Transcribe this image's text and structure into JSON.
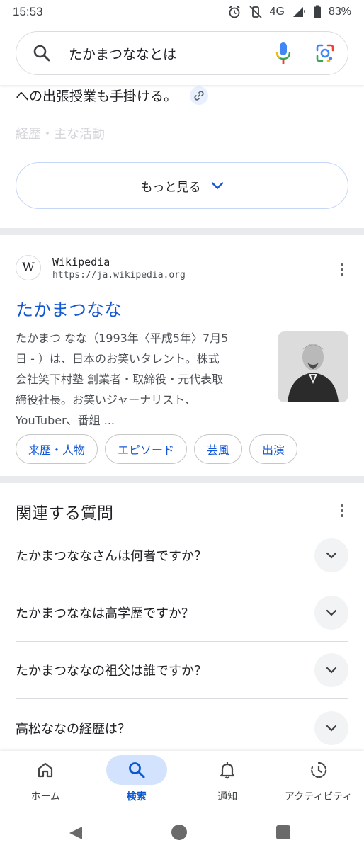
{
  "status_bar": {
    "time": "15:53",
    "network": "4G",
    "battery": "83%"
  },
  "search": {
    "query": "たかまつななとは"
  },
  "snippet": {
    "line": "への出張授業も手掛ける。",
    "faded_heading": "経歴・主な活動",
    "more_label": "もっと見る"
  },
  "result": {
    "favicon_letter": "W",
    "source_name": "Wikipedia",
    "source_url": "https://ja.wikipedia.org",
    "title": "たかまつなな",
    "snippet_lines": [
      "たかまつ なな（1993年〈平成5年〉7月5",
      "日 - ）は、日本のお笑いタレント。株式",
      "会社笑下村塾 創業者・取締役・元代表取",
      "締役社長。お笑いジャーナリスト、",
      "YouTuber、番組 ..."
    ],
    "chips": [
      "来歴・人物",
      "エピソード",
      "芸風",
      "出演"
    ]
  },
  "related_questions": {
    "title": "関連する質問",
    "items": [
      "たかまつななさんは何者ですか？",
      "たかまつななは高学歴ですか？",
      "たかまつななの祖父は誰ですか？",
      "高松ななの経歴は？"
    ]
  },
  "bottom_nav": {
    "items": [
      {
        "label": "ホーム",
        "icon": "home-icon",
        "active": false
      },
      {
        "label": "検索",
        "icon": "search-icon",
        "active": true
      },
      {
        "label": "通知",
        "icon": "bell-icon",
        "active": false
      },
      {
        "label": "アクティビティ",
        "icon": "activity-icon",
        "active": false
      }
    ]
  },
  "colors": {
    "link_blue": "#1558d6",
    "active_nav_bg": "#d3e3fd",
    "active_nav_text": "#0b57d0",
    "divider": "#e8eaed"
  }
}
